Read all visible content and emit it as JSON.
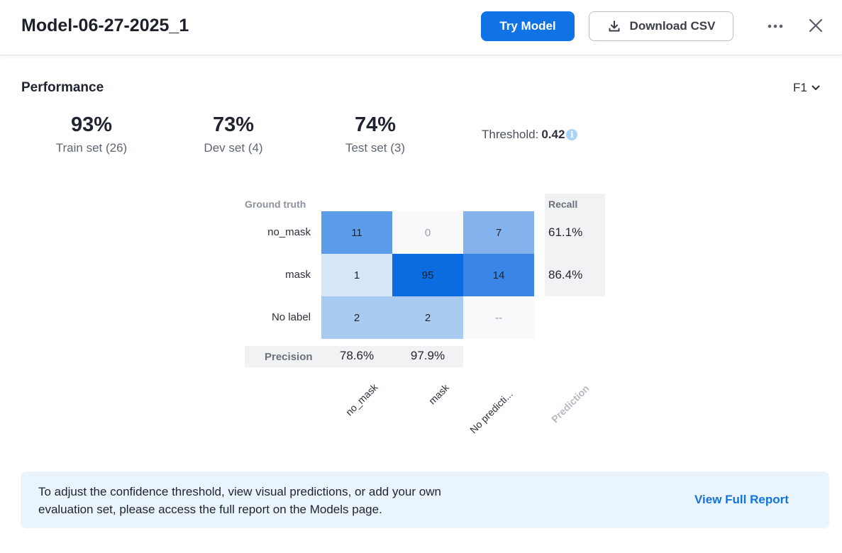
{
  "header": {
    "title": "Model-06-27-2025_1",
    "try_label": "Try Model",
    "download_label": "Download CSV"
  },
  "performance": {
    "title": "Performance",
    "metric": "F1",
    "stats": [
      {
        "value": "93%",
        "label": "Train set (26)"
      },
      {
        "value": "73%",
        "label": "Dev set (4)"
      },
      {
        "value": "74%",
        "label": "Test set (3)"
      }
    ],
    "threshold_label": "Threshold:",
    "threshold_value": "0.42"
  },
  "matrix": {
    "ground_truth_label": "Ground truth",
    "rows": [
      {
        "label": "no_mask",
        "cells": [
          "11",
          "0",
          "7"
        ],
        "recall": "61.1%"
      },
      {
        "label": "mask",
        "cells": [
          "1",
          "95",
          "14"
        ],
        "recall": "86.4%"
      },
      {
        "label": "No label",
        "cells": [
          "2",
          "2",
          "--"
        ],
        "recall": ""
      }
    ],
    "cell_colors": [
      [
        "#5d9ce8",
        "#f8f9fa",
        "#83b2ec"
      ],
      [
        "#d6e6f8",
        "#0b6ce0",
        "#3986e6"
      ],
      [
        "#aacbf1",
        "#aacbf1",
        "#f8f9fa"
      ]
    ],
    "cell_text_colors": [
      [
        "#1f2430",
        "#9aa0a8",
        "#1f2430"
      ],
      [
        "#1f2430",
        "#1f2430",
        "#1f2430"
      ],
      [
        "#1f2430",
        "#1f2430",
        "#8d939c"
      ]
    ],
    "recall_label": "Recall",
    "precision_label": "Precision",
    "precision": [
      "78.6%",
      "97.9%"
    ],
    "columns": [
      "no_mask",
      "mask",
      "No predicti..."
    ],
    "prediction_label": "Prediction"
  },
  "banner": {
    "text": "To adjust the confidence threshold, view visual predictions, or add your own evaluation set, please access the full report on the Models page.",
    "link_label": "View Full Report"
  }
}
